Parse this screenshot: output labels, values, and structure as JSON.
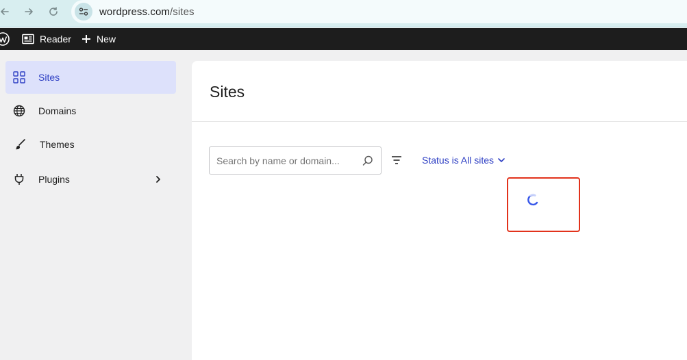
{
  "browser": {
    "url_domain": "wordpress.com",
    "url_path": "/sites",
    "icons": [
      "back-arrow-icon",
      "forward-arrow-icon",
      "reload-icon",
      "site-info-icon"
    ]
  },
  "admin_bar": {
    "reader_label": "Reader",
    "new_label": "New"
  },
  "sidebar": {
    "items": [
      {
        "label": "Sites",
        "icon": "grid-icon",
        "active": true
      },
      {
        "label": "Domains",
        "icon": "globe-icon",
        "active": false
      },
      {
        "label": "Themes",
        "icon": "brush-icon",
        "active": false
      },
      {
        "label": "Plugins",
        "icon": "plug-icon",
        "active": false,
        "has_submenu": true
      }
    ]
  },
  "main": {
    "title": "Sites",
    "search_placeholder": "Search by name or domain...",
    "status_filter_label": "Status is All sites"
  },
  "colors": {
    "accent": "#2f40c4",
    "active_bg": "#dde1fb",
    "highlight": "#e2321b",
    "admin_bar": "#1d1d1d",
    "browser_bar": "#d8eef0"
  }
}
